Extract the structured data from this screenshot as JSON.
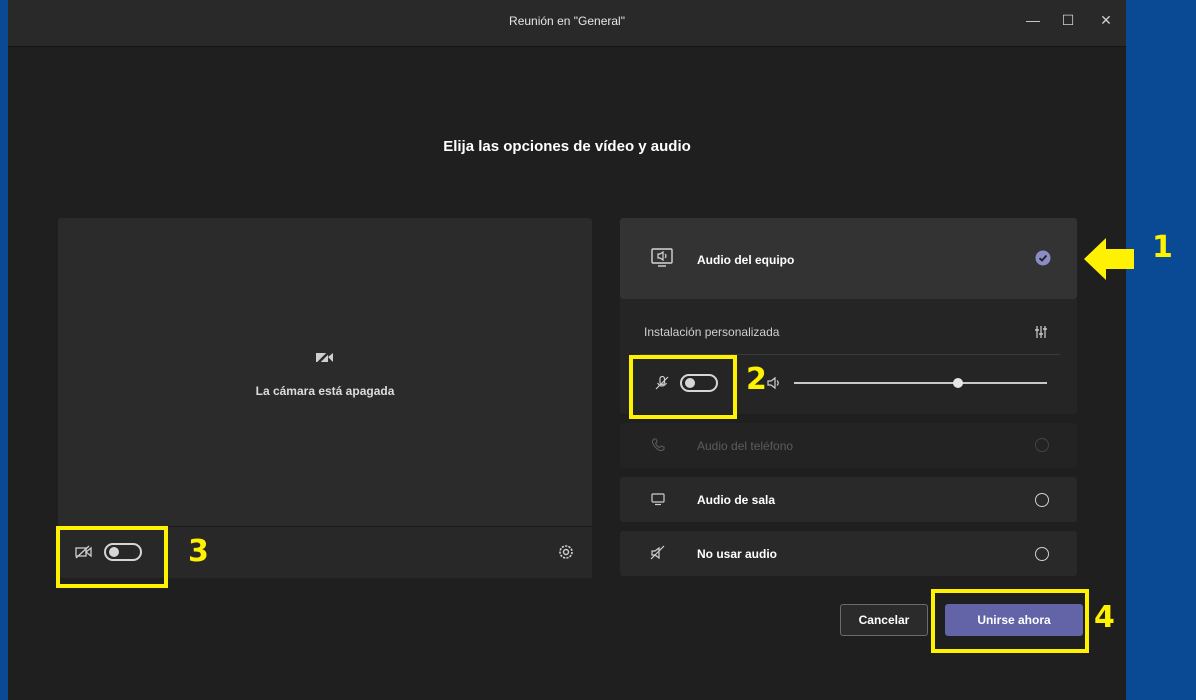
{
  "window": {
    "title": "Reunión en \"General\"",
    "controls": {
      "minimize": "—",
      "maximize": "☐",
      "close": "✕"
    }
  },
  "heading": "Elija las opciones de vídeo y audio",
  "video": {
    "camera_off_text": "La cámara está apagada",
    "camera_toggle_on": false
  },
  "audio": {
    "computer_audio": {
      "label": "Audio del equipo",
      "selected": true
    },
    "custom_setup": {
      "label": "Instalación personalizada",
      "mic_on": false,
      "volume_level": 0.65
    },
    "phone_audio": {
      "label": "Audio del teléfono",
      "disabled": true
    },
    "room_audio": {
      "label": "Audio de sala"
    },
    "no_audio": {
      "label": "No usar audio"
    }
  },
  "buttons": {
    "cancel": "Cancelar",
    "join": "Unirse ahora"
  },
  "annotations": {
    "n1": "1",
    "n2": "2",
    "n3": "3",
    "n4": "4"
  },
  "colors": {
    "accent": "#6264a7",
    "highlight": "#fff200",
    "background": "#0a4a94"
  }
}
